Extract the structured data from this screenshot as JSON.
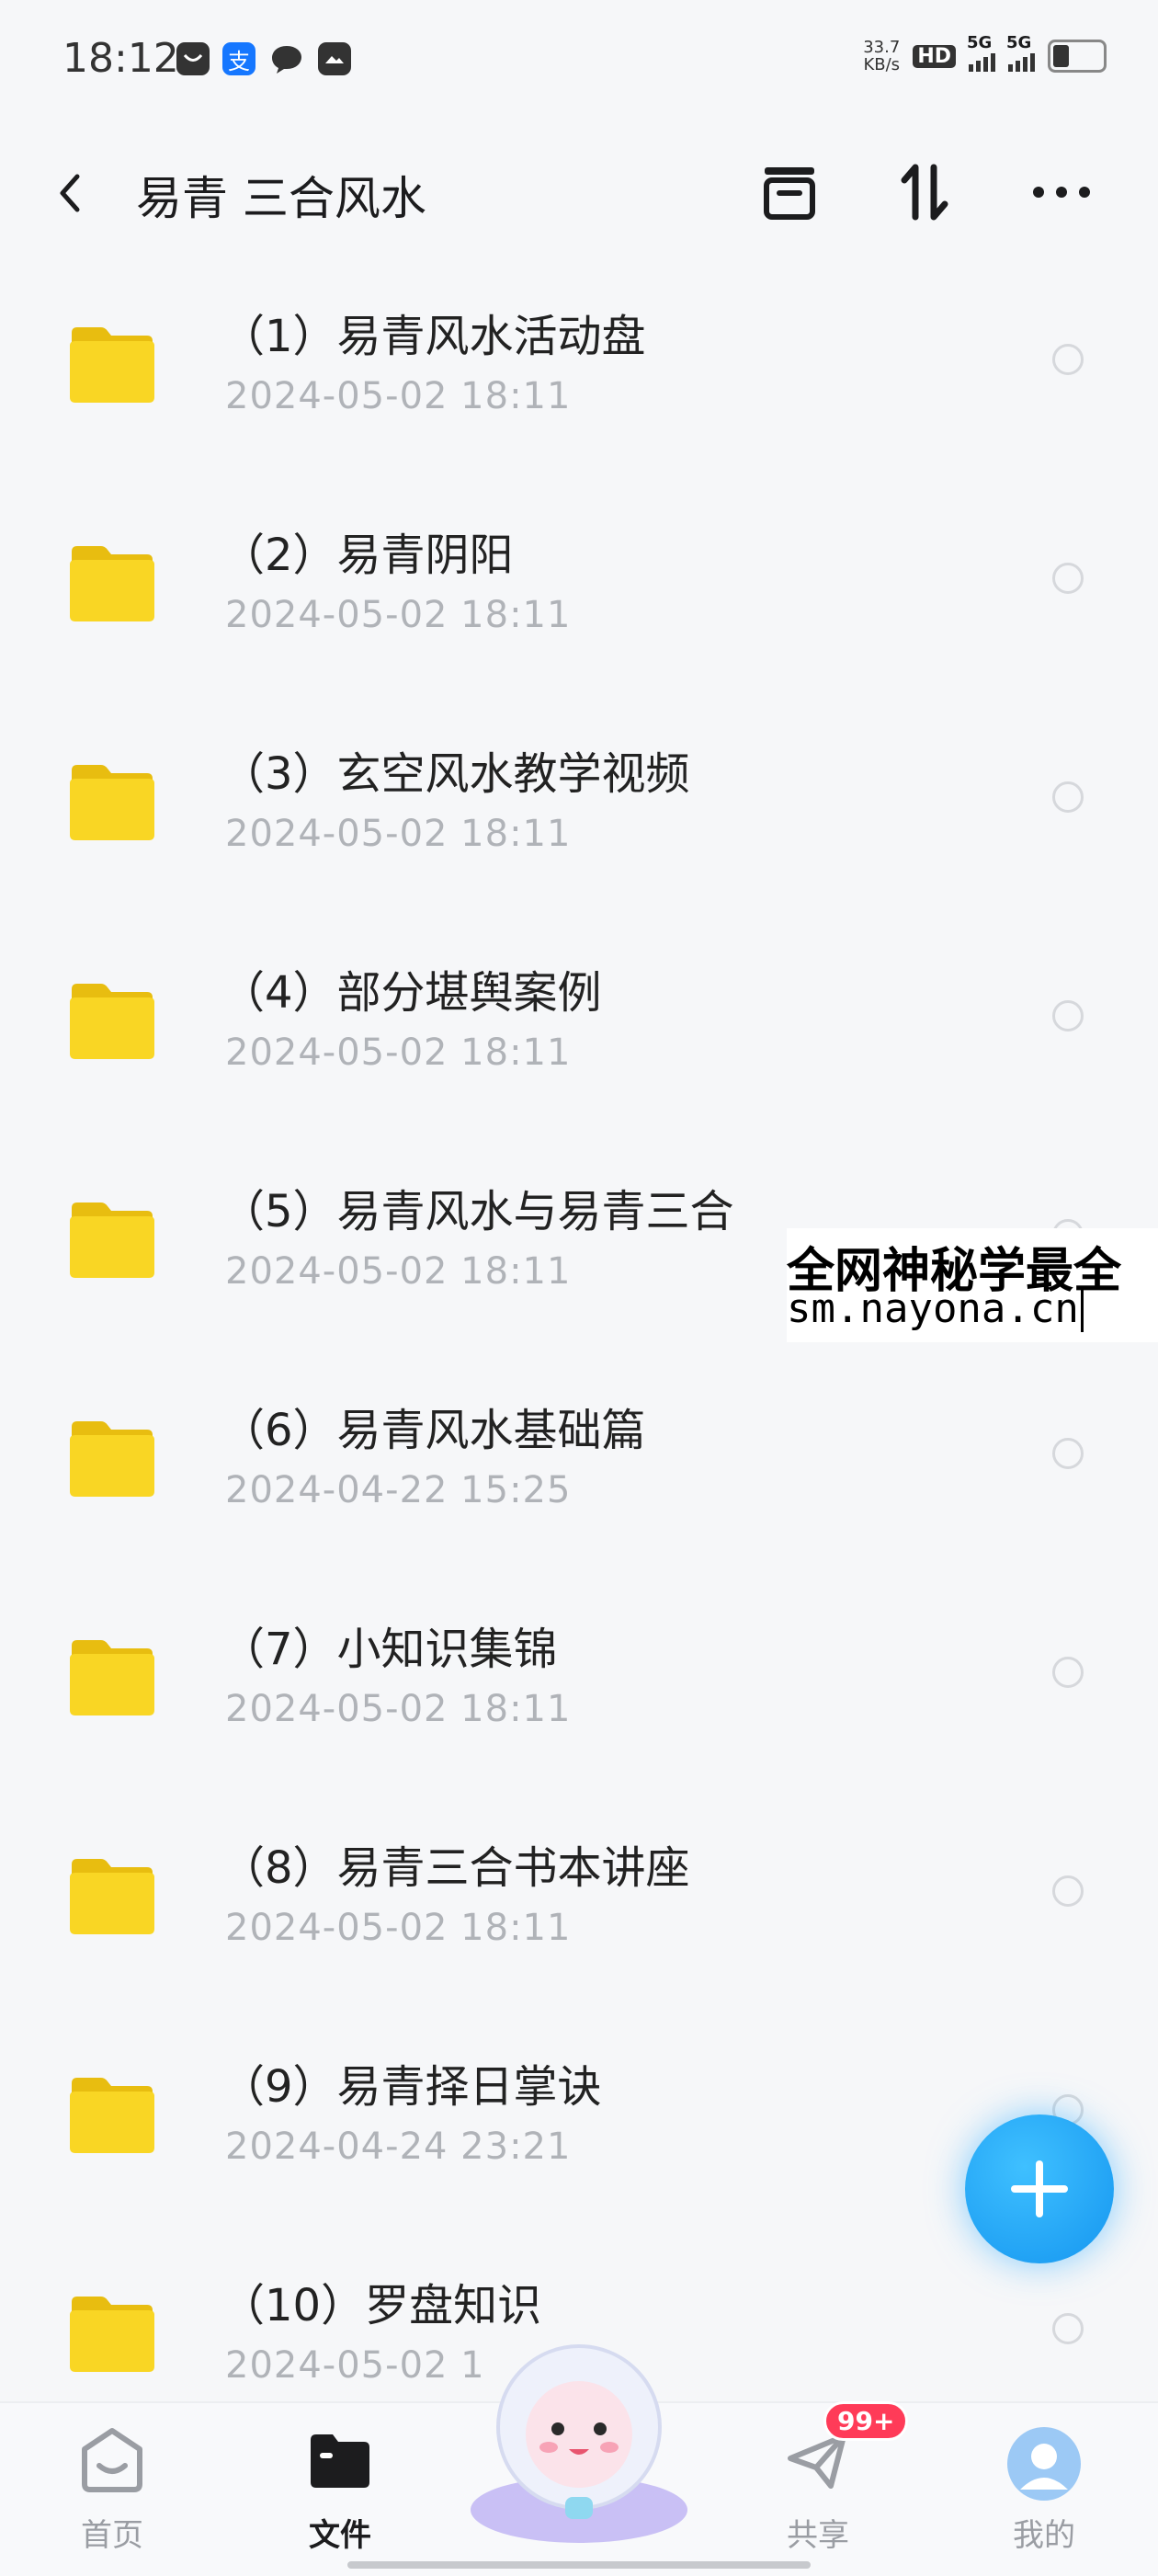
{
  "status_bar": {
    "time": "18:12",
    "alipay_char": "支",
    "net_speed_value": "33.7",
    "net_speed_unit": "KB/s",
    "hd_label": "HD",
    "sim1_label": "5G",
    "sim2_label": "5G"
  },
  "header": {
    "title": "易青 三合风水"
  },
  "folders": [
    {
      "name": "（1）易青风水活动盘",
      "date": "2024-05-02  18:11"
    },
    {
      "name": "（2）易青阴阳",
      "date": "2024-05-02  18:11"
    },
    {
      "name": "（3）玄空风水教学视频",
      "date": "2024-05-02  18:11"
    },
    {
      "name": "（4）部分堪舆案例",
      "date": "2024-05-02  18:11"
    },
    {
      "name": "（5）易青风水与易青三合",
      "date": "2024-05-02  18:11"
    },
    {
      "name": "（6）易青风水基础篇",
      "date": "2024-04-22  15:25"
    },
    {
      "name": "（7）小知识集锦",
      "date": "2024-05-02  18:11"
    },
    {
      "name": "（8）易青三合书本讲座",
      "date": "2024-05-02  18:11"
    },
    {
      "name": "（9）易青择日掌诀",
      "date": "2024-04-24  23:21"
    },
    {
      "name": "（10）罗盘知识",
      "date": "2024-05-02  1"
    }
  ],
  "watermark": {
    "line1": "全网神秘学最全",
    "line2": "sm.nayona.cn"
  },
  "bottom_nav": {
    "tabs": [
      {
        "label": "首页",
        "icon": "home-face-icon"
      },
      {
        "label": "文件",
        "icon": "folder-icon"
      },
      {
        "label": "共享",
        "icon": "paper-plane-icon",
        "badge": "99+"
      },
      {
        "label": "我的",
        "icon": "avatar-icon"
      }
    ]
  },
  "colors": {
    "accent": "#1596f0",
    "folder": "#f7d21e",
    "badge": "#ff3b58"
  }
}
